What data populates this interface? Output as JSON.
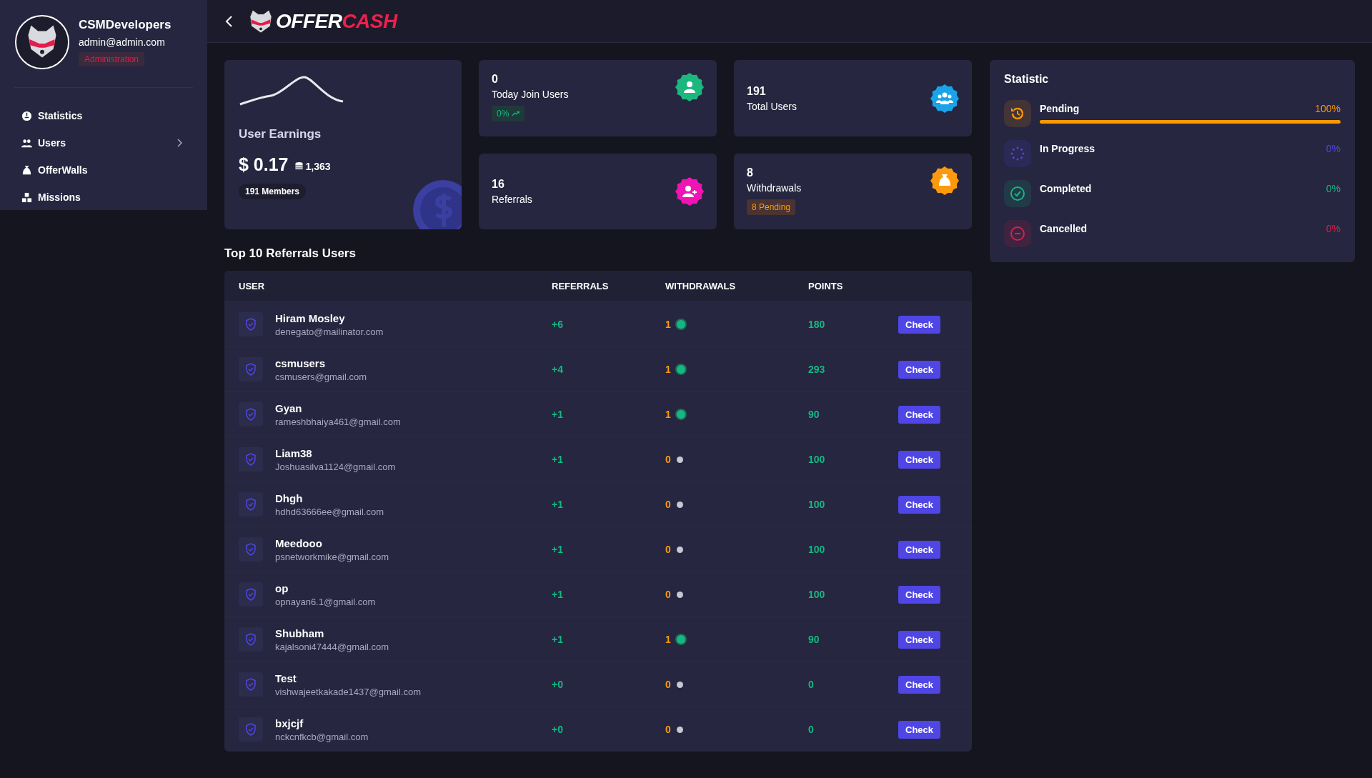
{
  "sidebar": {
    "profile": {
      "name": "CSMDevelopers",
      "email": "admin@admin.com",
      "role": "Administration"
    },
    "items": [
      {
        "kind": "statistics",
        "label": "Statistics",
        "has_submenu": false
      },
      {
        "kind": "users",
        "label": "Users",
        "has_submenu": true
      },
      {
        "kind": "offerwalls",
        "label": "OfferWalls",
        "has_submenu": false
      },
      {
        "kind": "missions",
        "label": "Missions",
        "has_submenu": false
      }
    ]
  },
  "header": {
    "logo": {
      "prefix": "OFFER",
      "suffix": "CASH"
    }
  },
  "earnings": {
    "title": "User Earnings",
    "currency": "$",
    "amount": "0.17",
    "coins": "1,363",
    "members": "191 Members"
  },
  "stat_cards": [
    {
      "kind": "user",
      "value": "0",
      "label": "Today Join Users",
      "color": "#1bb77f",
      "badge": {
        "kind": "trend",
        "text": "0%"
      }
    },
    {
      "kind": "users",
      "value": "191",
      "label": "Total Users",
      "color": "#1aa3e8"
    },
    {
      "kind": "user-plus",
      "value": "16",
      "label": "Referrals",
      "color": "#f014b4"
    },
    {
      "kind": "money-bag",
      "value": "8",
      "label": "Withdrawals",
      "color": "#fb9a0e",
      "badge": {
        "kind": "pending",
        "text": "8 Pending"
      }
    }
  ],
  "statistic": {
    "title": "Statistic",
    "items": [
      {
        "kind": "pending",
        "label": "Pending",
        "reading": "100%",
        "level": 1,
        "color": "#ff9800"
      },
      {
        "kind": "progress",
        "label": "In Progress",
        "reading": "0%",
        "color": "#4f46e5"
      },
      {
        "kind": "completed",
        "label": "Completed",
        "reading": "0%",
        "color": "#12b981"
      },
      {
        "kind": "cancelled",
        "label": "Cancelled",
        "reading": "0%",
        "color": "#e11d48"
      }
    ]
  },
  "table": {
    "title": "Top 10 Referrals Users",
    "columns": [
      "USER",
      "REFERRALS",
      "WITHDRAWALS",
      "POINTS"
    ],
    "rows": [
      {
        "name": "Hiram Mosley",
        "email": "denegato@mailinator.com",
        "referrals": "+6",
        "withdrawals": "1",
        "has_withdrawal": true,
        "points": "180",
        "action": "Check"
      },
      {
        "name": "csmusers",
        "email": "csmusers@gmail.com",
        "referrals": "+4",
        "withdrawals": "1",
        "has_withdrawal": true,
        "points": "293",
        "action": "Check"
      },
      {
        "name": "Gyan",
        "email": "rameshbhaiya461@gmail.com",
        "referrals": "+1",
        "withdrawals": "1",
        "has_withdrawal": true,
        "points": "90",
        "action": "Check"
      },
      {
        "name": "Liam38",
        "email": "Joshuasilva1124@gmail.com",
        "referrals": "+1",
        "withdrawals": "0",
        "has_withdrawal": false,
        "points": "100",
        "action": "Check"
      },
      {
        "name": "Dhgh",
        "email": "hdhd63666ee@gmail.com",
        "referrals": "+1",
        "withdrawals": "0",
        "has_withdrawal": false,
        "points": "100",
        "action": "Check"
      },
      {
        "name": "Meedooo",
        "email": "psnetworkmike@gmail.com",
        "referrals": "+1",
        "withdrawals": "0",
        "has_withdrawal": false,
        "points": "100",
        "action": "Check"
      },
      {
        "name": "op",
        "email": "opnayan6.1@gmail.com",
        "referrals": "+1",
        "withdrawals": "0",
        "has_withdrawal": false,
        "points": "100",
        "action": "Check"
      },
      {
        "name": "Shubham",
        "email": "kajalsoni47444@gmail.com",
        "referrals": "+1",
        "withdrawals": "1",
        "has_withdrawal": true,
        "points": "90",
        "action": "Check"
      },
      {
        "name": "Test",
        "email": "vishwajeetkakade1437@gmail.com",
        "referrals": "+0",
        "withdrawals": "0",
        "has_withdrawal": false,
        "points": "0",
        "action": "Check"
      },
      {
        "name": "bxjcjf",
        "email": "nckcnfkcb@gmail.com",
        "referrals": "+0",
        "withdrawals": "0",
        "has_withdrawal": false,
        "points": "0",
        "action": "Check"
      }
    ]
  }
}
